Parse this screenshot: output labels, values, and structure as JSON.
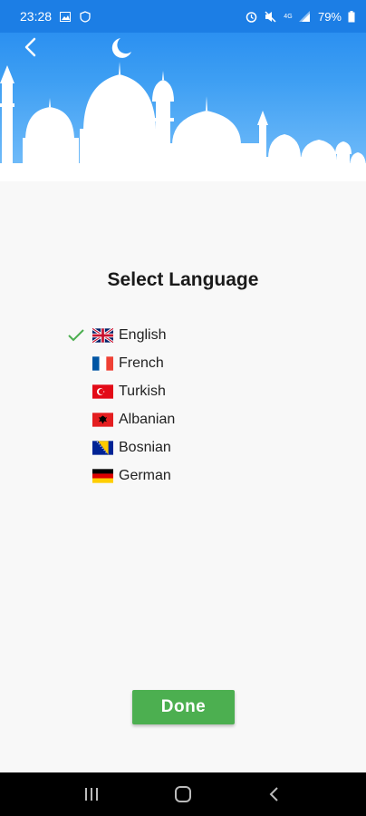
{
  "status_bar": {
    "time": "23:28",
    "battery": "79%",
    "icons": [
      "image-icon",
      "shield-icon",
      "alarm-icon",
      "mute-icon",
      "4g-icon",
      "signal-icon",
      "battery-icon"
    ]
  },
  "header": {
    "back_icon": "chevron-left-icon",
    "background_color": "#1f86ef"
  },
  "title": "Select Language",
  "languages": [
    {
      "label": "English",
      "flag": "uk-flag-icon",
      "selected": true
    },
    {
      "label": "French",
      "flag": "france-flag-icon",
      "selected": false
    },
    {
      "label": "Turkish",
      "flag": "turkey-flag-icon",
      "selected": false
    },
    {
      "label": "Albanian",
      "flag": "albania-flag-icon",
      "selected": false
    },
    {
      "label": "Bosnian",
      "flag": "bosnia-flag-icon",
      "selected": false
    },
    {
      "label": "German",
      "flag": "germany-flag-icon",
      "selected": false
    }
  ],
  "check_color": "#4caf50",
  "done_button": {
    "label": "Done",
    "color": "#4caf50"
  },
  "nav_bar": {
    "buttons": [
      "recents-icon",
      "home-icon",
      "back-icon"
    ]
  }
}
